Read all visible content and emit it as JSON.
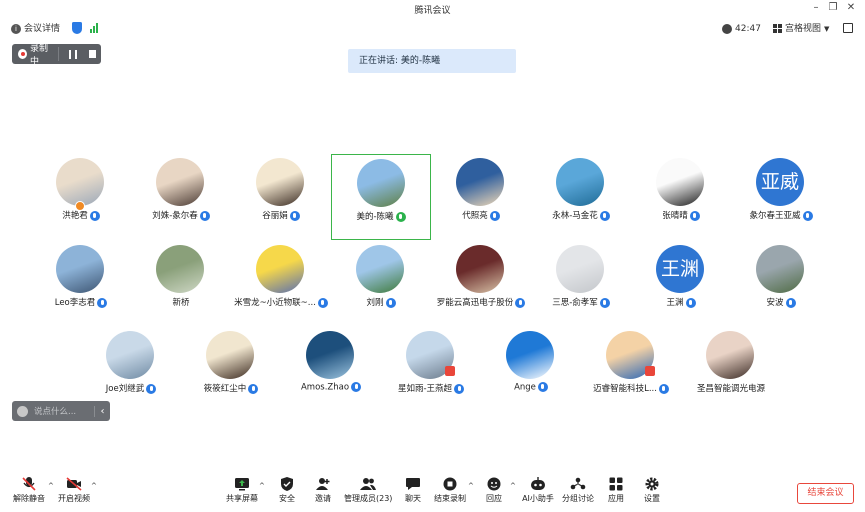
{
  "window": {
    "title": "腾讯会议"
  },
  "header": {
    "meeting_details": "会议详情",
    "timer": "42:47",
    "view_mode": "宫格视图"
  },
  "recording": {
    "label": "录制中"
  },
  "speaking": {
    "text": "正在讲话: 美的-陈曦"
  },
  "participants": [
    {
      "name": "洪艳君",
      "avatar_colors": [
        "#e9dccb",
        "#9aa7b8"
      ]
    },
    {
      "name": "刘姝-彖尔春",
      "avatar_colors": [
        "#e8d6c4",
        "#4a3a33"
      ]
    },
    {
      "name": "谷丽娟",
      "avatar_colors": [
        "#f3e7d0",
        "#3a2b22"
      ]
    },
    {
      "name": "美的-陈曦",
      "avatar_colors": [
        "#8cbbe5",
        "#5e7f44"
      ]
    },
    {
      "name": "代照亮",
      "avatar_colors": [
        "#2f5f9e",
        "#f0d9b7"
      ]
    },
    {
      "name": "永林-马金花",
      "avatar_colors": [
        "#5aa7d9",
        "#1f6b96"
      ]
    },
    {
      "name": "张晴晴",
      "avatar_colors": [
        "#fafafa",
        "#1c1c1c"
      ]
    },
    {
      "name": "彖尔春王亚威",
      "avatar_text": "亚威"
    },
    {
      "name": "Leo李志君",
      "avatar_colors": [
        "#8db3d8",
        "#3d5572"
      ]
    },
    {
      "name": "新桥",
      "avatar_colors": [
        "#8aa07a",
        "#cfd8c6"
      ]
    },
    {
      "name": "米雪龙~小近物联~...",
      "avatar_colors": [
        "#f6d84a",
        "#5a6fb0"
      ]
    },
    {
      "name": "刘刚",
      "avatar_colors": [
        "#9fc6e8",
        "#3e7a3a"
      ]
    },
    {
      "name": "罗能云高迅电子股份",
      "avatar_colors": [
        "#6a2b2b",
        "#d9c3a8"
      ]
    },
    {
      "name": "三思-俞孝军",
      "avatar_colors": [
        "#e3e5e8",
        "#c3c6ca"
      ]
    },
    {
      "name": "王渊",
      "avatar_text": "王渊"
    },
    {
      "name": "安波",
      "avatar_colors": [
        "#9aa6ad",
        "#4f6b44"
      ]
    },
    {
      "name": "Joe刘继武",
      "avatar_colors": [
        "#c9d9e8",
        "#6f8aa3"
      ]
    },
    {
      "name": "筱筱红尘中",
      "avatar_colors": [
        "#f1e6cf",
        "#3b2a20"
      ]
    },
    {
      "name": "Amos.Zhao",
      "avatar_colors": [
        "#1d4f7c",
        "#9cc4df"
      ]
    },
    {
      "name": "星如雨-王燕超",
      "avatar_colors": [
        "#c5d8ea",
        "#6b7b8c"
      ]
    },
    {
      "name": "Ange",
      "avatar_colors": [
        "#1f79d6",
        "#ffffff"
      ]
    },
    {
      "name": "迈睿智能科技L...",
      "avatar_colors": [
        "#f4d2a6",
        "#2b66b5"
      ]
    },
    {
      "name": "圣昌智能调光电源",
      "avatar_colors": [
        "#e9d3c6",
        "#3a2a24"
      ]
    }
  ],
  "chat": {
    "placeholder": "说点什么..."
  },
  "toolbar": {
    "mute": "解除静音",
    "video": "开启视频",
    "share": "共享屏幕",
    "security": "安全",
    "invite": "邀请",
    "members": "管理成员(23)",
    "chat": "聊天",
    "stop_record": "结束录制",
    "react": "回应",
    "ai": "AI小助手",
    "breakout": "分组讨论",
    "apps": "应用",
    "settings": "设置",
    "end": "结束会议"
  },
  "colors": {
    "accent": "#2a7ae4",
    "active_border": "#3bb54a",
    "danger": "#e8473c"
  }
}
